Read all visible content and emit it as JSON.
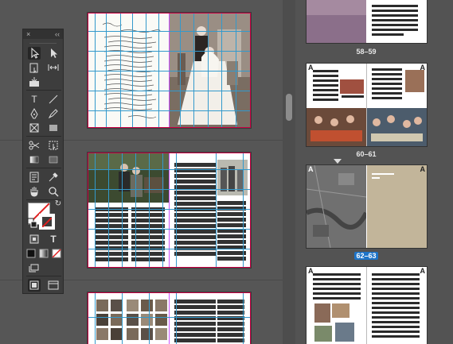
{
  "tools_panel": {
    "close_label": "×",
    "collapse_label": "‹‹",
    "type_tool_glyph": "T",
    "formatting_text_glyph": "T"
  },
  "pages_panel": {
    "labels": [
      "58–59",
      "60–61",
      "62–63"
    ],
    "selected_label": "62–63",
    "master_letter": "A"
  },
  "colors": {
    "selection": "#1e74c8",
    "guide_cyan": "#33c4e0",
    "guide_magenta": "#cc55ff",
    "bleed_red": "#cc0044"
  }
}
